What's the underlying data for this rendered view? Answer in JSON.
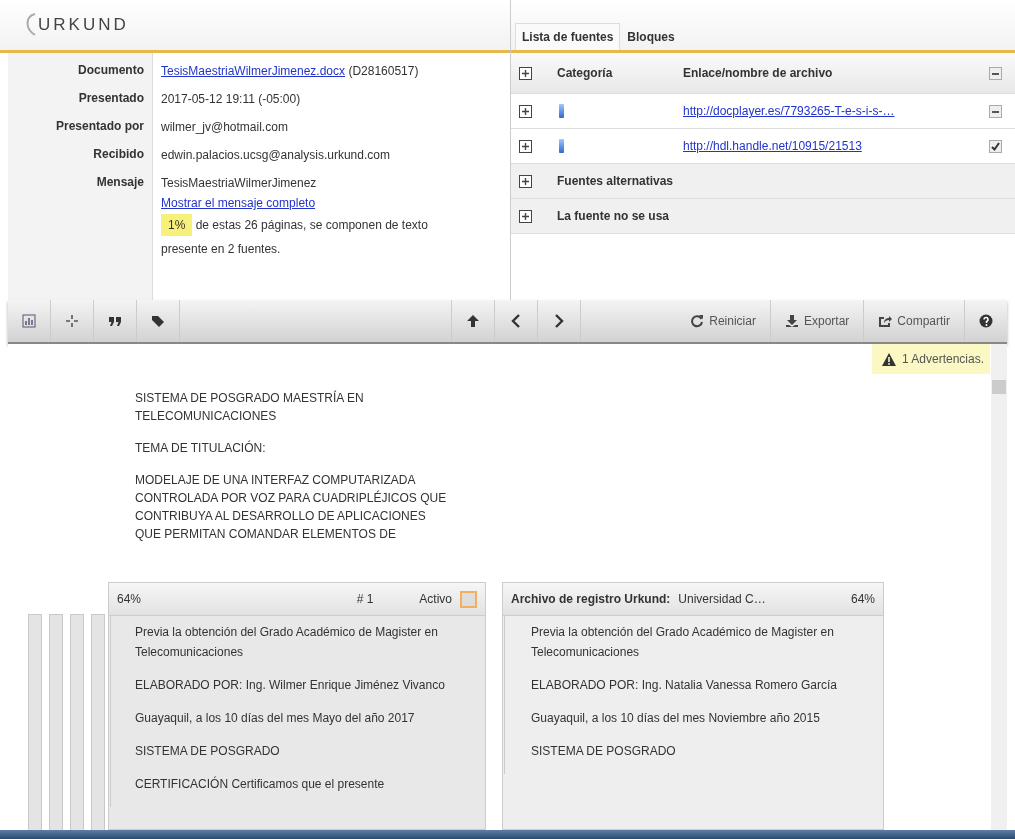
{
  "logo": "URKUND",
  "info": {
    "rows": [
      {
        "label": "Documento",
        "link": "TesisMaestriaWilmerJimenez.docx",
        "value": "(D28160517)"
      },
      {
        "label": "Presentado",
        "value": "2017-05-12 19:11 (-05:00)"
      },
      {
        "label": "Presentado por",
        "value": "wilmer_jv@hotmail.com"
      },
      {
        "label": "Recibido",
        "value": "edwin.palacios.ucsg@analysis.urkund.com"
      },
      {
        "label": "Mensaje",
        "value": "TesisMaestriaWilmerJimenez",
        "link": "Mostrar el mensaje completo"
      }
    ],
    "summary": {
      "percent": "1%",
      "text": "de estas 26 páginas, se componen de texto presente en 2 fuentes."
    }
  },
  "tabs": [
    {
      "label": "Lista de fuentes",
      "selected": true
    },
    {
      "label": "Bloques",
      "selected": false
    }
  ],
  "sources": {
    "columns": [
      "Categoría",
      "Enlace/nombre de archivo"
    ],
    "all_checked": true,
    "all_partial": true,
    "rows": [
      {
        "link": "http://docplayer.es/7793265-T-e-s-i-s-…",
        "checked": true,
        "partial": true
      },
      {
        "link": "http://hdl.handle.net/10915/21513",
        "checked": true,
        "partial": false
      }
    ],
    "groups": [
      {
        "label": "Fuentes alternativas",
        "expanded": false
      },
      {
        "label": "La fuente no se usa",
        "expanded": false
      }
    ]
  },
  "toolbar": {
    "actions": [
      "Reiniciar",
      "Exportar",
      "Compartir"
    ]
  },
  "warning": "1 Advertencias.",
  "document": [
    "SISTEMA DE POSGRADO MAESTRÍA EN TELECOMUNICACIONES",
    "TEMA DE TITULACIÓN:",
    "MODELAJE DE UNA INTERFAZ COMPUTARIZADA CONTROLADA POR VOZ PARA CUADRIPLÉJICOS QUE CONTRIBUYA AL DESARROLLO DE APLICACIONES QUE PERMITAN COMANDAR ELEMENTOS DE"
  ],
  "match": {
    "left": {
      "percent": "64%",
      "number": "# 1",
      "active_label": "Activo",
      "active": false,
      "paragraphs": [
        "Previa la obtención del Grado Académico de Magister en Telecomunicaciones",
        "ELABORADO POR: Ing. Wilmer Enrique Jiménez Vivanco",
        "Guayaquil, a los 10 días del mes Mayo del año 2017",
        "SISTEMA DE POSGRADO",
        "CERTIFICACIÓN Certificamos que el presente"
      ]
    },
    "right": {
      "title": "Archivo de registro Urkund:",
      "source": "Universidad C…",
      "percent": "64%",
      "paragraphs": [
        "Previa la obtención del Grado Académico de Magister en Telecomunicaciones",
        "ELABORADO POR: Ing. Natalia Vanessa Romero García",
        "Guayaquil, a los 10 días del mes Noviembre año 2015",
        "SISTEMA DE POSGRADO"
      ]
    }
  }
}
